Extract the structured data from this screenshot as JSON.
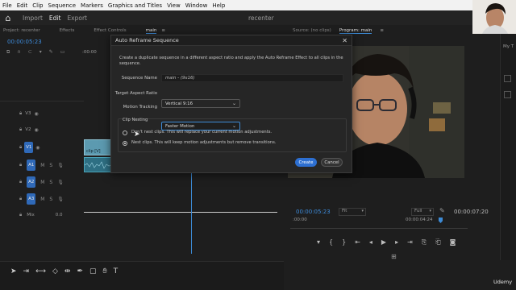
{
  "menubar": [
    "File",
    "Edit",
    "Clip",
    "Sequence",
    "Markers",
    "Graphics and Titles",
    "View",
    "Window",
    "Help"
  ],
  "workspace": {
    "tabs": [
      "Import",
      "Edit",
      "Export"
    ],
    "active": "Edit",
    "title": "recenter"
  },
  "source_panel": {
    "tabs": [
      "Project: recenter",
      "Effects",
      "Effect Controls",
      "main"
    ],
    "timecode": "00:00:05:23",
    "ruler_label": ":00:00"
  },
  "tracks": {
    "video": [
      "V3",
      "V2",
      "V1"
    ],
    "audio": [
      "A1",
      "A2",
      "A3"
    ],
    "clip_label": "clip [V]",
    "mix_label": "Mix",
    "mix_value": "0.0",
    "m_label": "M",
    "s_label": "S"
  },
  "dialog": {
    "title": "Auto Reframe Sequence",
    "description": "Create a duplicate sequence in a different aspect ratio and apply the Auto Reframe Effect to all clips in the sequence.",
    "sequence_name_label": "Sequence Name",
    "sequence_name_value": "main - (9x16)",
    "aspect_label": "Target Aspect Ratio",
    "aspect_value": "Vertical 9:16",
    "tracking_label": "Motion Tracking",
    "tracking_value": "Faster Motion",
    "nesting_title": "Clip Nesting",
    "nest_option_1": "Don't nest clips. This will replace your current motion adjustments.",
    "nest_option_2": "Nest clips. This will keep motion adjustments but remove transitions.",
    "create_label": "Create",
    "cancel_label": "Cancel"
  },
  "program": {
    "tabs": [
      "Source: (no clips)",
      "Program: main"
    ],
    "timecode": "00:00:05:23",
    "fit": "Fit",
    "full": "Full",
    "duration": "00:00:07:20",
    "ruler_start": ":00:00",
    "ruler_mid": "00:00:04:24"
  },
  "right_panel": {
    "label": "My T"
  },
  "watermark": "Udemy",
  "colors": {
    "accent": "#3d8bd6",
    "track_blue": "#2f69b8",
    "clip_teal": "#4aa3b8",
    "create": "#2d6fd1"
  }
}
